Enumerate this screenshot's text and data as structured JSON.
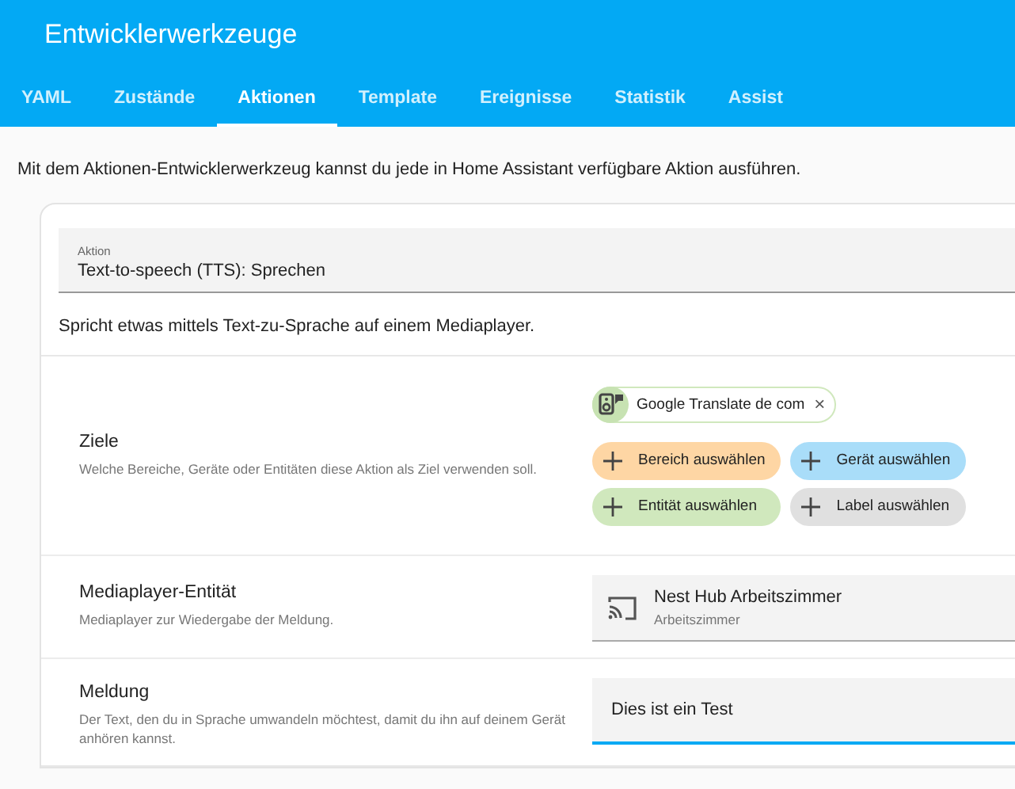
{
  "header": {
    "title": "Entwicklerwerkzeuge"
  },
  "tabs": [
    {
      "label": "YAML",
      "selected": false
    },
    {
      "label": "Zustände",
      "selected": false
    },
    {
      "label": "Aktionen",
      "selected": true
    },
    {
      "label": "Template",
      "selected": false
    },
    {
      "label": "Ereignisse",
      "selected": false
    },
    {
      "label": "Statistik",
      "selected": false
    },
    {
      "label": "Assist",
      "selected": false
    }
  ],
  "intro": "Mit dem Aktionen-Entwicklerwerkzeug kannst du jede in Home Assistant verfügbare Aktion ausführen.",
  "action_field": {
    "label": "Aktion",
    "value": "Text-to-speech (TTS): Sprechen"
  },
  "action_description": "Spricht etwas mittels Text-zu-Sprache auf einem Mediaplayer.",
  "targets": {
    "title": "Ziele",
    "description": "Welche Bereiche, Geräte oder Entitäten diese Aktion als Ziel verwenden soll.",
    "selected": [
      {
        "label": "Google Translate de com",
        "remove": "×"
      }
    ],
    "add_buttons": [
      {
        "label": "Bereich auswählen",
        "color": "#fed6a4"
      },
      {
        "label": "Gerät auswählen",
        "color": "#a9ddf9"
      },
      {
        "label": "Entität auswählen",
        "color": "#d0e8bd"
      },
      {
        "label": "Label auswählen",
        "color": "#e0e0e0"
      }
    ]
  },
  "fields": [
    {
      "kind": "entity",
      "title": "Mediaplayer-Entität",
      "description": "Mediaplayer zur Wiedergabe der Meldung.",
      "value": "Nest Hub Arbeitszimmer",
      "secondary": "Arbeitszimmer",
      "focused": false
    },
    {
      "kind": "text",
      "title": "Meldung",
      "description": "Der Text, den du in Sprache umwandeln möchtest, damit du ihn auf deinem Gerät anhören kannst.",
      "value": "Dies ist ein Test",
      "focused": true
    }
  ]
}
